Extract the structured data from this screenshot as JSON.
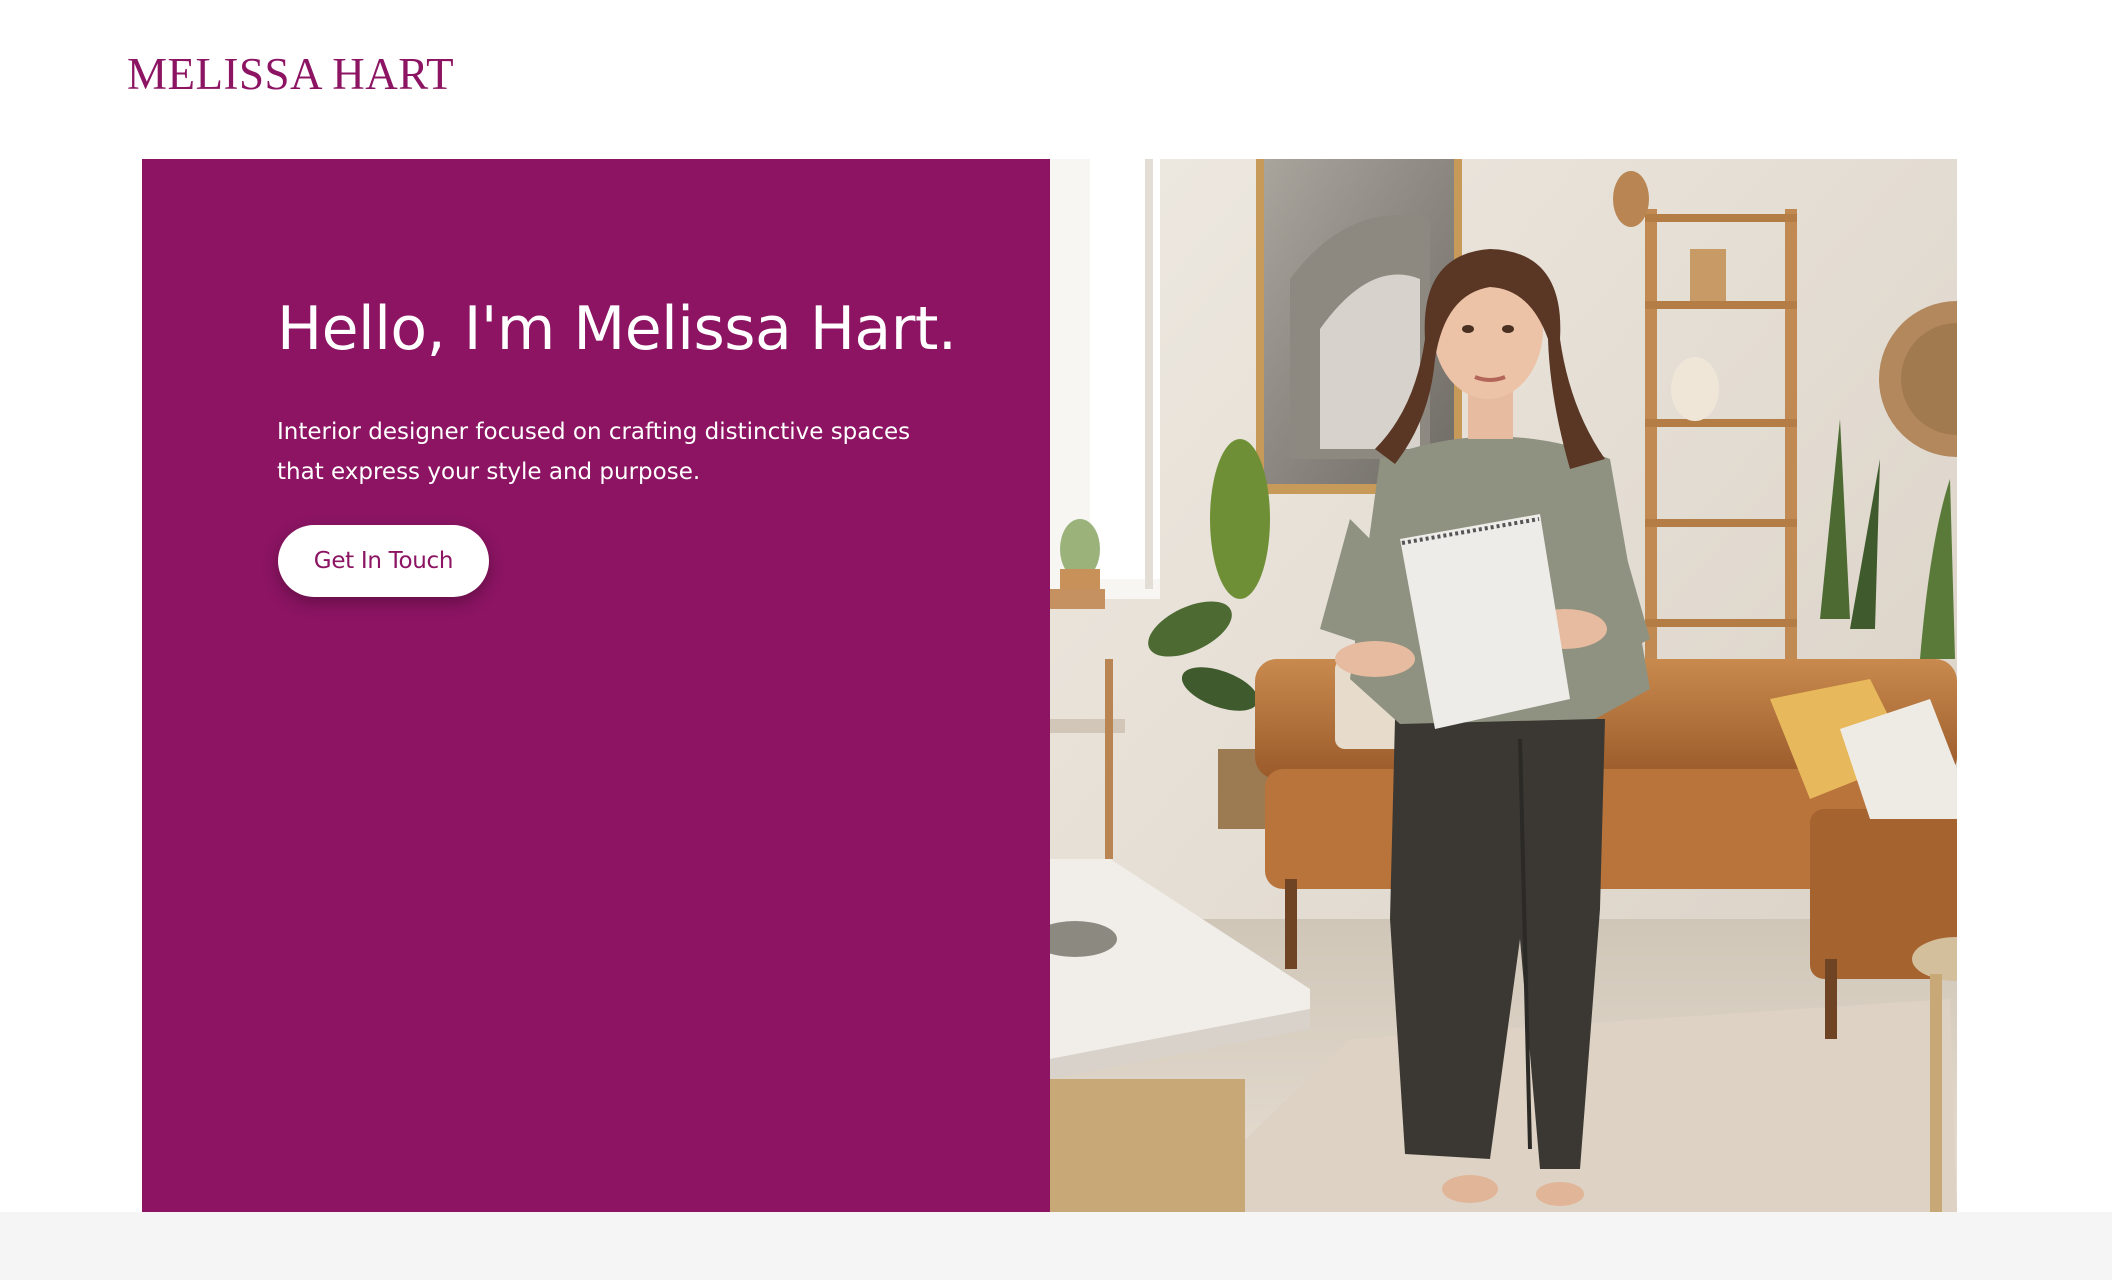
{
  "header": {
    "brand": "MELISSA HART"
  },
  "hero": {
    "title": "Hello, I'm Melissa Hart.",
    "subtitle": "Interior designer focused on crafting distinctive spaces that express your style and purpose.",
    "cta_label": "Get In Touch",
    "photo_icon": "portrait-photo"
  },
  "colors": {
    "brand": "#8c1463",
    "panel": "#8c1463",
    "button_bg": "#ffffff",
    "footer_band": "#f5f5f5"
  }
}
